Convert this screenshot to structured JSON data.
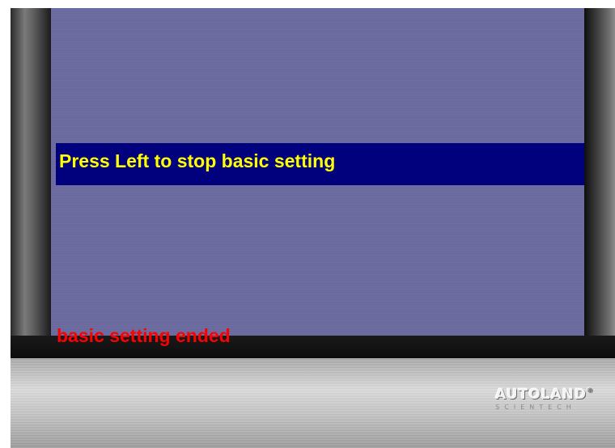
{
  "screen": {
    "prompt": "Press Left to stop basic setting",
    "status": "basic setting ended"
  },
  "logo": {
    "brand": "AUTOLAND",
    "registered": "®",
    "sub": "SCIENTECH"
  },
  "colors": {
    "screen_bg": "#6a6a9e",
    "prompt_bar": "#01017e",
    "prompt_text": "#ffff00",
    "status_text": "#ff0000"
  }
}
